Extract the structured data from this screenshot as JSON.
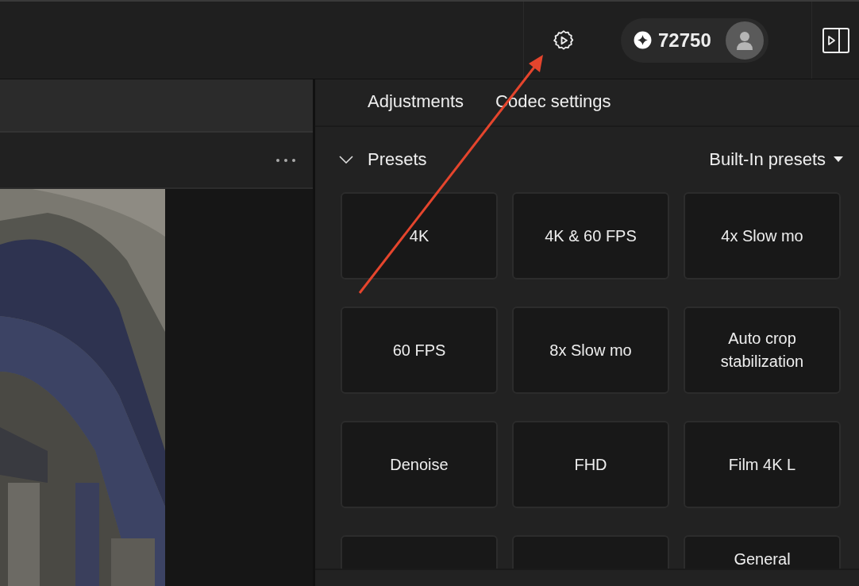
{
  "top_bar": {
    "credits": "72750"
  },
  "tabs": [
    {
      "label": "Adjustments",
      "selected": false
    },
    {
      "label": "Codec settings",
      "selected": false
    }
  ],
  "presets": {
    "title": "Presets",
    "expanded": true,
    "source": "Built-In presets",
    "items": [
      {
        "kind": "preset",
        "label": "4K"
      },
      {
        "kind": "preset",
        "label": "4K & 60 FPS"
      },
      {
        "kind": "preset",
        "label": "4x Slow mo"
      },
      {
        "kind": "preset",
        "label": "60 FPS"
      },
      {
        "kind": "preset",
        "label": "8x Slow mo"
      },
      {
        "kind": "preset",
        "label": "Auto crop stabilization"
      },
      {
        "kind": "preset",
        "label": "Denoise"
      },
      {
        "kind": "preset",
        "label": "FHD"
      },
      {
        "kind": "preset",
        "label": "Film 4K L"
      },
      {
        "kind": "blank"
      },
      {
        "kind": "blank"
      },
      {
        "kind": "preset",
        "label": "General"
      }
    ]
  }
}
